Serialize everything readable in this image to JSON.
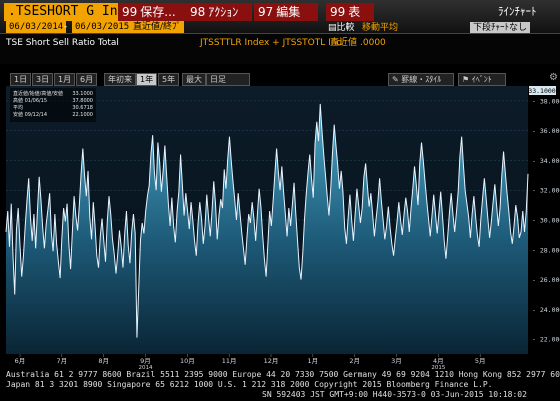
{
  "header": {
    "ticker": ".TSESHORT G Index",
    "menu": [
      {
        "num": "99",
        "label": "保存..."
      },
      {
        "num": "98",
        "label": "ｱｸｼｮﾝ"
      },
      {
        "num": "97",
        "label": "編集"
      },
      {
        "num": "99",
        "label": "表"
      }
    ],
    "window_label": "ﾗｲﾝﾁｬｰﾄ",
    "date_from": "06/03/2014",
    "date_to": "06/03/2015",
    "field_label": "直近値/終ﾌﾟ",
    "compare_label": "比較",
    "moving_avg_label": "移動平均",
    "chart_type_label": "下段ﾁｬｰﾄなし",
    "subtitle": "TSE Short Sell Ratio Total",
    "overlay_label": "JTSSTTLR Index + JTSSTOTL Ind",
    "overlay_value_label": "直近値",
    "overlay_value": ".0000",
    "periods": [
      "1日",
      "3日",
      "1月",
      "6月",
      "年初来",
      "1年",
      "5年",
      "最大",
      "日足"
    ],
    "active_period": "1年",
    "tools": [
      "罫線・ｽﾀｲﾙ",
      "ｲﾍﾞﾝﾄ"
    ]
  },
  "legend": {
    "title": "直近値/始値/高値/安値",
    "rows": [
      {
        "label": "直近値/始値/高値/安値",
        "value": "33.1000"
      },
      {
        "label": "高値 01/06/15",
        "value": "37.8000"
      },
      {
        "label": "平均",
        "value": "30.6718"
      },
      {
        "label": "安値 09/12/14",
        "value": "22.1000"
      }
    ]
  },
  "chart_data": {
    "type": "area",
    "ylim": [
      21.0,
      39.0
    ],
    "yticks": [
      "22.0000",
      "24.0000",
      "26.0000",
      "28.0000",
      "30.0000",
      "32.0000",
      "34.0000",
      "36.0000",
      "38.0000"
    ],
    "last_value": "33.1000",
    "x_month_labels": [
      "6月",
      "7月",
      "8月",
      "9月",
      "10月",
      "11月",
      "12月",
      "1月",
      "2月",
      "3月",
      "4月",
      "5月"
    ],
    "x_year_labels": [
      "2014",
      "2015"
    ],
    "values": [
      29.2,
      30.6,
      28.2,
      31.1,
      27.6,
      25.0,
      29.4,
      30.8,
      28.3,
      26.2,
      27.6,
      29.6,
      31.3,
      32.8,
      30.2,
      28.6,
      30.4,
      28.1,
      30.6,
      32.9,
      31.4,
      29.5,
      28.1,
      29.7,
      30.7,
      31.8,
      29.1,
      27.9,
      30.4,
      28.4,
      27.2,
      26.1,
      28.8,
      30.8,
      29.9,
      31.1,
      28.4,
      26.7,
      29.2,
      31.6,
      30.3,
      29.3,
      31.0,
      33.1,
      34.8,
      33.0,
      31.6,
      33.3,
      30.2,
      28.7,
      31.2,
      29.6,
      27.6,
      26.8,
      28.9,
      30.1,
      28.6,
      27.2,
      29.9,
      31.6,
      30.4,
      28.7,
      27.7,
      26.4,
      27.7,
      29.3,
      28.2,
      26.8,
      29.1,
      30.6,
      28.3,
      27.1,
      29.2,
      30.4,
      29.1,
      22.1,
      25.3,
      28.6,
      29.8,
      29.1,
      30.6,
      31.6,
      32.3,
      34.4,
      35.7,
      33.2,
      32.0,
      35.2,
      33.9,
      31.9,
      33.3,
      35.0,
      33.0,
      31.1,
      29.6,
      31.5,
      29.6,
      28.5,
      30.6,
      31.9,
      34.4,
      32.4,
      30.3,
      31.8,
      30.6,
      29.4,
      31.2,
      30.0,
      28.6,
      27.6,
      29.8,
      31.2,
      30.1,
      28.4,
      29.6,
      31.7,
      30.2,
      28.9,
      30.6,
      32.6,
      31.1,
      28.7,
      30.3,
      31.4,
      30.8,
      33.4,
      32.1,
      34.1,
      35.6,
      34.0,
      32.6,
      31.4,
      30.0,
      31.8,
      30.5,
      29.2,
      28.1,
      27.0,
      28.8,
      30.4,
      29.8,
      31.2,
      30.1,
      28.6,
      30.4,
      32.1,
      30.9,
      29.0,
      27.4,
      26.2,
      28.4,
      30.6,
      29.6,
      31.3,
      33.1,
      34.8,
      33.2,
      32.0,
      33.6,
      31.9,
      30.4,
      28.9,
      30.8,
      29.6,
      31.0,
      32.5,
      30.4,
      28.6,
      26.8,
      26.0,
      27.8,
      30.1,
      31.8,
      33.2,
      34.4,
      32.8,
      31.5,
      35.1,
      36.6,
      35.3,
      37.8,
      36.0,
      34.4,
      33.0,
      31.6,
      30.3,
      32.1,
      34.5,
      36.4,
      35.0,
      33.7,
      32.1,
      33.3,
      31.9,
      29.5,
      28.4,
      30.2,
      31.7,
      30.0,
      28.6,
      30.4,
      32.1,
      31.0,
      29.8,
      30.8,
      32.9,
      33.8,
      32.3,
      30.9,
      31.8,
      30.4,
      28.9,
      30.1,
      31.2,
      32.8,
      31.3,
      30.0,
      28.7,
      29.6,
      30.9,
      29.5,
      28.4,
      27.6,
      28.8,
      29.9,
      31.2,
      30.0,
      29.0,
      30.4,
      31.5,
      30.6,
      29.2,
      30.8,
      32.1,
      33.6,
      32.4,
      31.0,
      33.8,
      35.2,
      34.0,
      32.6,
      31.3,
      30.1,
      28.9,
      30.3,
      31.7,
      30.4,
      29.1,
      30.5,
      31.9,
      30.3,
      28.6,
      27.4,
      28.9,
      30.5,
      31.8,
      30.4,
      29.2,
      30.5,
      31.9,
      34.3,
      35.6,
      33.7,
      32.0,
      31.1,
      30.2,
      28.8,
      30.4,
      31.6,
      30.2,
      29.0,
      28.2,
      30.1,
      31.5,
      32.8,
      31.5,
      30.1,
      28.8,
      29.9,
      31.2,
      32.4,
      31.0,
      29.6,
      30.8,
      33.0,
      34.6,
      33.2,
      31.8,
      30.6,
      29.2,
      28.4,
      29.6,
      31.0,
      30.2,
      28.8,
      29.2,
      30.6,
      29.2,
      30.6,
      33.1
    ]
  },
  "footer": {
    "line1": "Australia 61 2 9777 8600 Brazil 5511 2395 9000 Europe 44 20 7330 7500 Germany 49 69 9204 1210 Hong Kong 852 2977 6000",
    "line2": "Japan 81 3 3201 8900        Singapore 65 6212 1000      U.S. 1 212 318 2000          Copyright 2015 Bloomberg Finance L.P.",
    "line3": "SN 592403 JST  GMT+9:00 H440-3573-0 03-Jun-2015 10:18:02"
  }
}
